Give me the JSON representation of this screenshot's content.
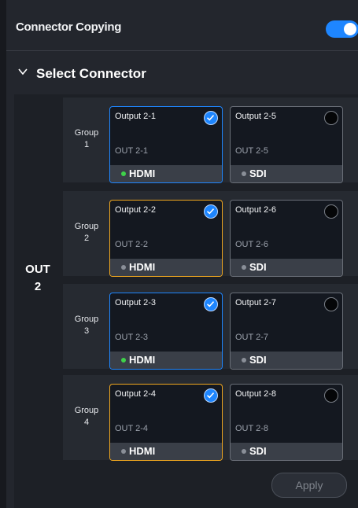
{
  "header": {
    "title": "Connector Copying",
    "toggle_on": true
  },
  "section": {
    "title": "Select Connector"
  },
  "output": {
    "label_line1": "OUT",
    "label_line2": "2"
  },
  "groups": [
    {
      "label_line1": "Group",
      "label_line2": "1",
      "cards": [
        {
          "title": "Output 2-1",
          "sub": "OUT 2-1",
          "type": "HDMI",
          "selected": true,
          "signal": true
        },
        {
          "title": "Output 2-5",
          "sub": "OUT 2-5",
          "type": "SDI",
          "selected": false,
          "signal": false
        }
      ]
    },
    {
      "label_line1": "Group",
      "label_line2": "2",
      "cards": [
        {
          "title": "Output 2-2",
          "sub": "OUT 2-2",
          "type": "HDMI",
          "selected": true,
          "signal": false
        },
        {
          "title": "Output 2-6",
          "sub": "OUT 2-6",
          "type": "SDI",
          "selected": false,
          "signal": false
        }
      ]
    },
    {
      "label_line1": "Group",
      "label_line2": "3",
      "cards": [
        {
          "title": "Output 2-3",
          "sub": "OUT 2-3",
          "type": "HDMI",
          "selected": true,
          "signal": true
        },
        {
          "title": "Output 2-7",
          "sub": "OUT 2-7",
          "type": "SDI",
          "selected": false,
          "signal": false
        }
      ]
    },
    {
      "label_line1": "Group",
      "label_line2": "4",
      "cards": [
        {
          "title": "Output 2-4",
          "sub": "OUT 2-4",
          "type": "HDMI",
          "selected": true,
          "signal": false
        },
        {
          "title": "Output 2-8",
          "sub": "OUT 2-8",
          "type": "SDI",
          "selected": false,
          "signal": false
        }
      ]
    }
  ],
  "footer": {
    "apply_label": "Apply"
  },
  "colors": {
    "accent": "#1e86ff",
    "selected_orange": "#f0a71f",
    "signal_green": "#3fd24a"
  }
}
